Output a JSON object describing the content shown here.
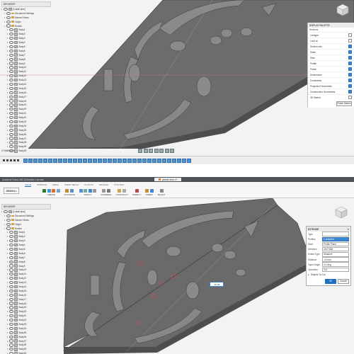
{
  "browser": {
    "header": "BROWSER",
    "root": "[Lokalt plan]",
    "items": [
      "Document Settings",
      "Named Views",
      "Origin",
      "Bodies"
    ],
    "bodies_top": [
      "Body1",
      "Body2",
      "Body3",
      "Body4",
      "Body5",
      "Body6",
      "Body7",
      "Body8",
      "Body9",
      "Body10",
      "Body11",
      "Body12",
      "Body13",
      "Body14",
      "Body15",
      "Body16",
      "Body17",
      "Body18",
      "Body19",
      "Body20",
      "Body21",
      "Body22",
      "Body23",
      "Body24",
      "Body25",
      "Body26",
      "Body27",
      "Body28",
      "Body29",
      "Body30"
    ],
    "bodies_bottom": [
      "Body1",
      "Body2",
      "Body3",
      "Body4",
      "Body5",
      "Body6",
      "Body7",
      "Body8",
      "Body9",
      "Body10",
      "Body11",
      "Body12",
      "Body13",
      "Body14",
      "Body15",
      "Body16",
      "Body17",
      "Body18",
      "Body19",
      "Body20",
      "Body21",
      "Body22",
      "Body23",
      "Body24",
      "Body25",
      "Body26",
      "Body27",
      "Body28",
      "Body29",
      "Body30",
      "Body31",
      "Body32"
    ]
  },
  "display": {
    "title": "DISPLAY PALETTE",
    "section": "Sections",
    "items": [
      {
        "label": "Linetype",
        "on": false
      },
      {
        "label": "Look at",
        "on": false
      },
      {
        "label": "Section Info",
        "on": true
      },
      {
        "label": "Sides",
        "on": true
      },
      {
        "label": "Slice",
        "on": true
      },
      {
        "label": "Profile",
        "on": true
      },
      {
        "label": "Points",
        "on": true
      },
      {
        "label": "Dimensions",
        "on": true
      },
      {
        "label": "Constraints",
        "on": true
      },
      {
        "label": "Projected Geometries",
        "on": true
      },
      {
        "label": "Construction Geometries",
        "on": true
      },
      {
        "label": "3D Sketch",
        "on": false
      }
    ],
    "finish": "Finish Sketch"
  },
  "comments": "COMMENTS",
  "titlebar": "Autodesk Fusion 360 (Education License)",
  "doctab": "pinball deck v7",
  "workspace": "DESIGN",
  "tabs": [
    "SOLID",
    "SURFACE",
    "MESH",
    "SHEET METAL",
    "PLASTIC",
    "MANAGE",
    "UTILITIES"
  ],
  "groups": [
    {
      "label": "CREATE",
      "colors": [
        "#2a7d2e",
        "#3f9ad6",
        "#e06b2a",
        "#6fa3d6"
      ]
    },
    {
      "label": "AUTOMATE",
      "colors": [
        "#c38a2a",
        "#5b8fc9"
      ]
    },
    {
      "label": "MODIFY",
      "colors": [
        "#4f90d0",
        "#7aa",
        "#3b86d6",
        "#999"
      ]
    },
    {
      "label": "ASSEMBLE",
      "colors": [
        "#999",
        "#777"
      ]
    },
    {
      "label": "CONSTRUCT",
      "colors": [
        "#c9a44a",
        "#aaa"
      ]
    },
    {
      "label": "INSPECT",
      "colors": [
        "#b64b4b"
      ]
    },
    {
      "label": "INSERT",
      "colors": [
        "#c48e3a",
        "#3b86d6"
      ]
    },
    {
      "label": "SELECT",
      "colors": [
        "#888"
      ]
    }
  ],
  "extrude": {
    "title": "EXTRUDE",
    "rows": [
      {
        "k": "Type",
        "v": ""
      },
      {
        "k": "Profiles",
        "v": "1 selected",
        "blue": true
      },
      {
        "k": "Start",
        "v": "Profile Plane"
      },
      {
        "k": "Direction",
        "v": "One Side"
      },
      {
        "k": "Extent Type",
        "v": "Distance"
      },
      {
        "k": "Distance",
        "v": "-10 mm"
      },
      {
        "k": "Taper Angle",
        "v": "0.0 deg"
      },
      {
        "k": "Operation",
        "v": "Cut"
      }
    ],
    "objects": "Objects To Cut",
    "ok": "OK",
    "cancel": "Cancel"
  },
  "dim_value": "-10.00"
}
